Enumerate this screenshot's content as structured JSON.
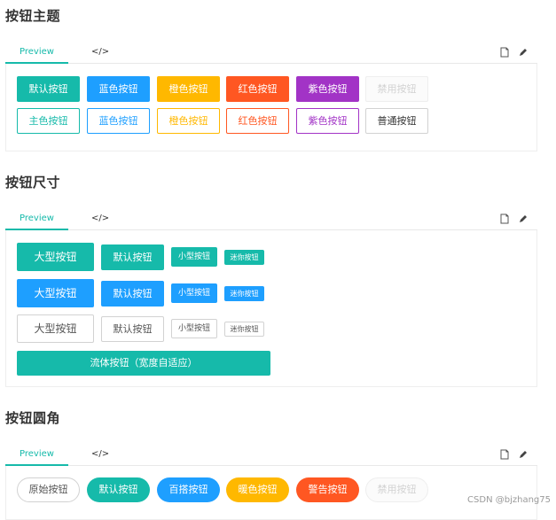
{
  "colors": {
    "theme": "#16baaa",
    "blue": "#1e9fff",
    "orange": "#ffb800",
    "red": "#ff5722",
    "purple": "#a233c6",
    "disabled_bg": "#fbfbfb",
    "disabled_text": "#d2d2d2",
    "text": "#333333"
  },
  "tabs": {
    "preview": "Preview",
    "code": "</>"
  },
  "icons": {
    "copy": "copy-icon",
    "edit": "pencil-icon"
  },
  "theme_section": {
    "title": "按钮主题",
    "row1": [
      "默认按钮",
      "蓝色按钮",
      "橙色按钮",
      "红色按钮",
      "紫色按钮",
      "禁用按钮"
    ],
    "row2": [
      "主色按钮",
      "蓝色按钮",
      "橙色按钮",
      "红色按钮",
      "紫色按钮",
      "普通按钮"
    ]
  },
  "size_section": {
    "title": "按钮尺寸",
    "sizes": [
      "大型按钮",
      "默认按钮",
      "小型按钮",
      "迷你按钮"
    ],
    "fluid": "流体按钮（宽度自适应）"
  },
  "radius_section": {
    "title": "按钮圆角",
    "buttons": [
      "原始按钮",
      "默认按钮",
      "百搭按钮",
      "暖色按钮",
      "警告按钮",
      "禁用按钮"
    ]
  },
  "watermark": "CSDN @bjzhang75"
}
